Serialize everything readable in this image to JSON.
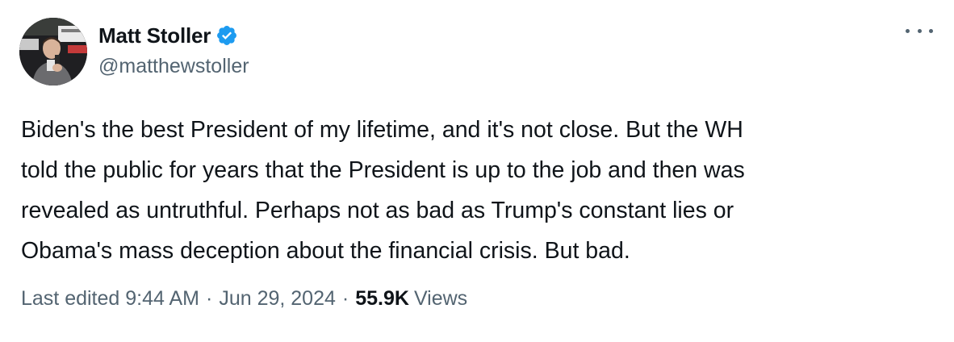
{
  "author": {
    "display_name": "Matt Stoller",
    "handle": "@matthewstoller",
    "verified": true
  },
  "tweet": {
    "text": "Biden's the best President of my lifetime, and it's not close. But the WH\ntold the public for years that the President is up to the job and then was\nrevealed as untruthful. Perhaps not as bad as Trump's constant lies or\nObama's mass deception about the financial crisis. But bad."
  },
  "meta": {
    "edited_label": "Last edited 9:44 AM",
    "separator": "·",
    "date": "Jun 29, 2024",
    "views_count": "55.9K",
    "views_label": "Views"
  },
  "colors": {
    "verified_badge": "#1d9bf0",
    "secondary_text": "#536471",
    "primary_text": "#0f1419"
  },
  "icons": {
    "verified": "verified-badge-icon",
    "more": "more-horizontal-icon"
  }
}
